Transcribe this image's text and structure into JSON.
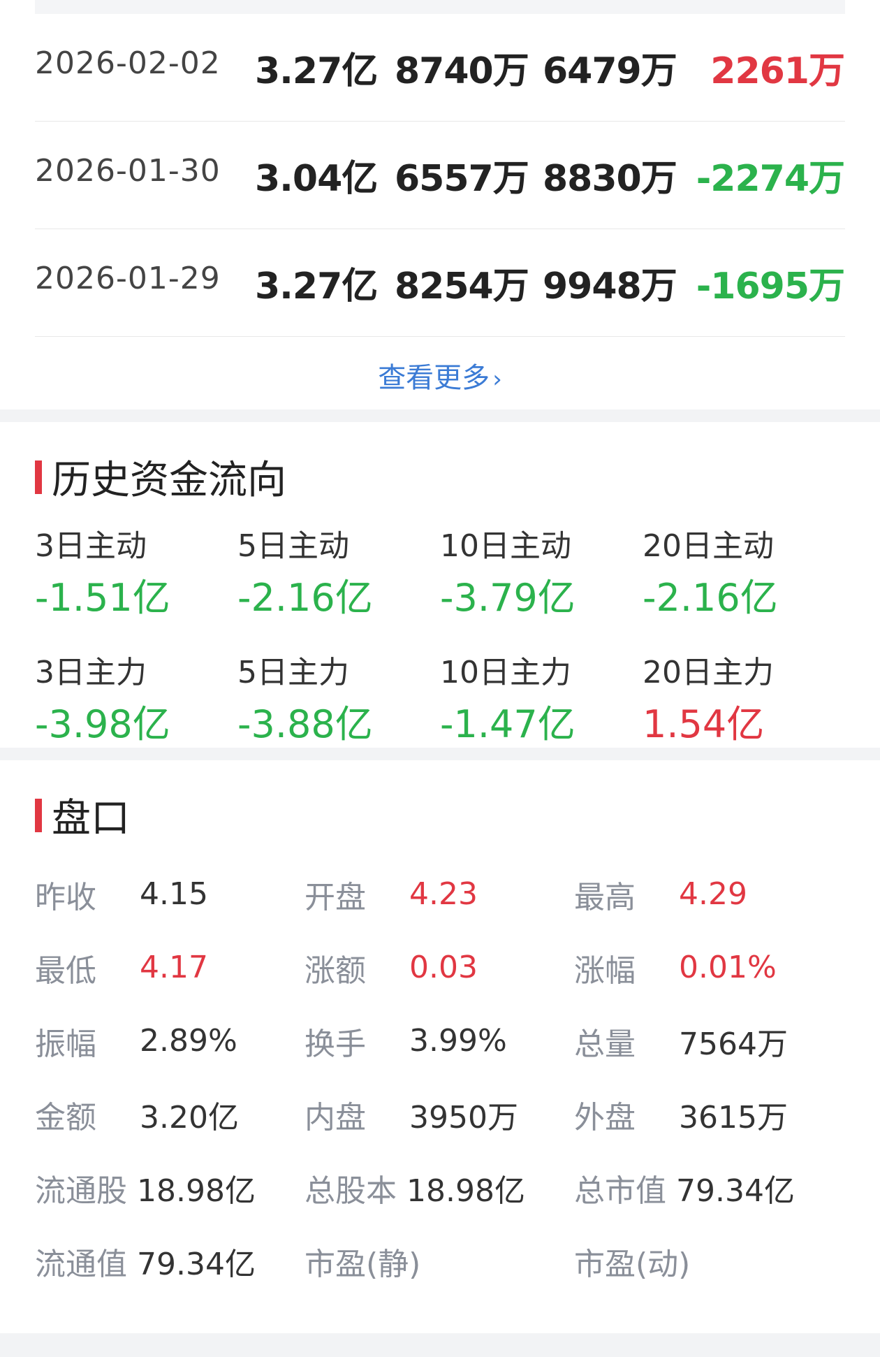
{
  "flow_rows": [
    {
      "date": "2026-02-02",
      "col1": "3.27亿",
      "col2": "8740万",
      "col3": "6479万",
      "col4": "2261万",
      "col4_color": "#e13742"
    },
    {
      "date": "2026-01-30",
      "col1": "3.04亿",
      "col2": "6557万",
      "col3": "8830万",
      "col4": "-2274万",
      "col4_color": "#2bb24c"
    },
    {
      "date": "2026-01-29",
      "col1": "3.27亿",
      "col2": "8254万",
      "col3": "9948万",
      "col4": "-1695万",
      "col4_color": "#2bb24c"
    }
  ],
  "more_label": "查看更多",
  "history": {
    "title": "历史资金流向",
    "items": [
      {
        "label": "3日主动",
        "value": "-1.51亿",
        "color": "#2bb24c"
      },
      {
        "label": "5日主动",
        "value": "-2.16亿",
        "color": "#2bb24c"
      },
      {
        "label": "10日主动",
        "value": "-3.79亿",
        "color": "#2bb24c"
      },
      {
        "label": "20日主动",
        "value": "-2.16亿",
        "color": "#2bb24c"
      },
      {
        "label": "3日主力",
        "value": "-3.98亿",
        "color": "#2bb24c"
      },
      {
        "label": "5日主力",
        "value": "-3.88亿",
        "color": "#2bb24c"
      },
      {
        "label": "10日主力",
        "value": "-1.47亿",
        "color": "#2bb24c"
      },
      {
        "label": "20日主力",
        "value": "1.54亿",
        "color": "#e13742"
      }
    ]
  },
  "pankou": {
    "title": "盘口",
    "items": [
      {
        "label": "昨收",
        "value": "4.15",
        "color": "#333333"
      },
      {
        "label": "开盘",
        "value": "4.23",
        "color": "#e13742"
      },
      {
        "label": "最高",
        "value": "4.29",
        "color": "#e13742"
      },
      {
        "label": "最低",
        "value": "4.17",
        "color": "#e13742"
      },
      {
        "label": "涨额",
        "value": "0.03",
        "color": "#e13742"
      },
      {
        "label": "涨幅",
        "value": "0.01%",
        "color": "#e13742"
      },
      {
        "label": "振幅",
        "value": "2.89%",
        "color": "#333333"
      },
      {
        "label": "换手",
        "value": "3.99%",
        "color": "#333333"
      },
      {
        "label": "总量",
        "value": "7564万",
        "color": "#333333"
      },
      {
        "label": "金额",
        "value": "3.20亿",
        "color": "#333333"
      },
      {
        "label": "内盘",
        "value": "3950万",
        "color": "#333333"
      },
      {
        "label": "外盘",
        "value": "3615万",
        "color": "#333333"
      },
      {
        "label": "流通股",
        "value": "18.98亿",
        "color": "#333333"
      },
      {
        "label": "总股本",
        "value": "18.98亿",
        "color": "#333333"
      },
      {
        "label": "总市值",
        "value": "79.34亿",
        "color": "#333333"
      },
      {
        "label": "流通值",
        "value": "79.34亿",
        "color": "#333333"
      },
      {
        "label": "市盈(静)",
        "value": "",
        "color": "#333333"
      },
      {
        "label": "市盈(动)",
        "value": "",
        "color": "#333333"
      }
    ]
  },
  "icons": {
    "more_chevron": "chevron-right-icon"
  }
}
